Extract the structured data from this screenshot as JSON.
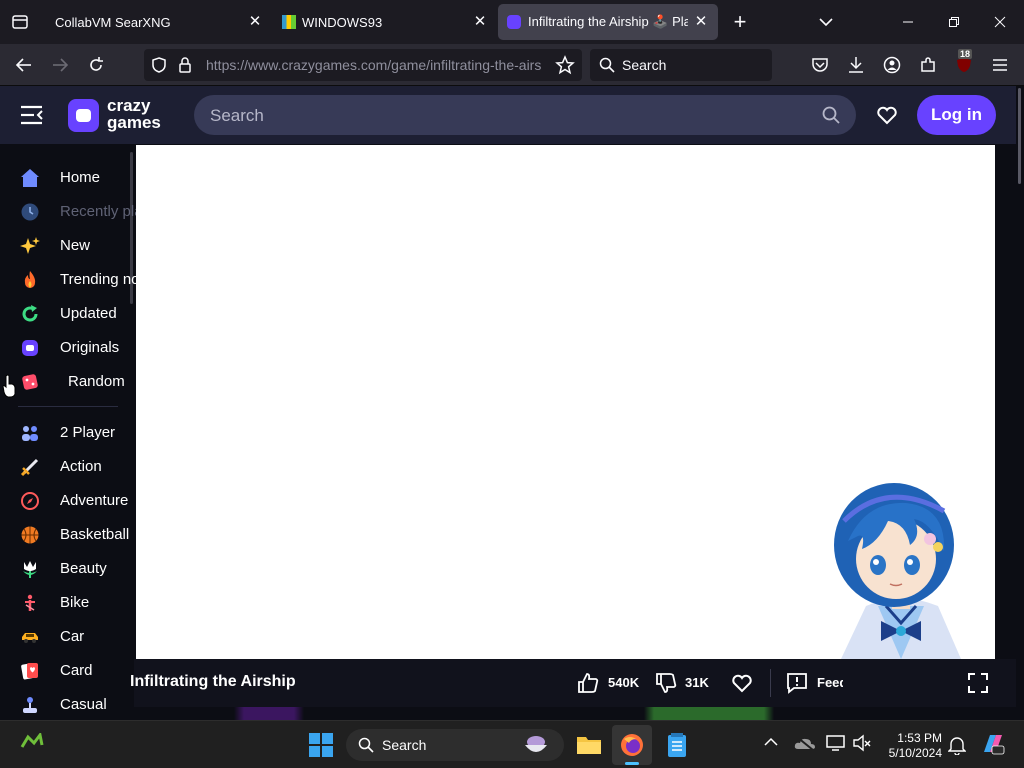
{
  "browser": {
    "tabs": [
      {
        "title": "CollabVM SearXNG",
        "active": false
      },
      {
        "title": "WINDOWS93",
        "active": false
      },
      {
        "title": "Infiltrating the Airship 🕹️ Play",
        "active": true
      }
    ],
    "url": "https://www.crazygames.com/game/infiltrating-the-airs",
    "search_placeholder": "Search",
    "extension_badge": "18"
  },
  "site": {
    "logo_line1": "crazy",
    "logo_line2": "games",
    "search_placeholder": "Search",
    "login_label": "Log in",
    "accent": "#6842ff"
  },
  "sidebar": {
    "items": [
      {
        "label": "Home",
        "icon": "home-icon"
      },
      {
        "label": "Recently played",
        "icon": "clock-icon"
      },
      {
        "label": "New",
        "icon": "sparkle-icon"
      },
      {
        "label": "Trending now",
        "icon": "fire-icon"
      },
      {
        "label": "Updated",
        "icon": "refresh-icon"
      },
      {
        "label": "Originals",
        "icon": "crazygames-logo-icon"
      },
      {
        "label": "Random",
        "icon": "dice-icon"
      },
      {
        "label": "2 Player",
        "icon": "two-player-icon"
      },
      {
        "label": "Action",
        "icon": "sword-icon"
      },
      {
        "label": "Adventure",
        "icon": "compass-icon"
      },
      {
        "label": "Basketball",
        "icon": "basketball-icon"
      },
      {
        "label": "Beauty",
        "icon": "flower-icon"
      },
      {
        "label": "Bike",
        "icon": "bike-icon"
      },
      {
        "label": "Car",
        "icon": "car-icon"
      },
      {
        "label": "Card",
        "icon": "cards-icon"
      },
      {
        "label": "Casual",
        "icon": "joystick-icon"
      }
    ]
  },
  "game": {
    "title": "Infiltrating the Airship",
    "likes": "540K",
    "dislikes": "31K",
    "feedback_label": "Feedback"
  },
  "taskbar": {
    "search_placeholder": "Search",
    "time": "1:53 PM",
    "date": "5/10/2024"
  }
}
